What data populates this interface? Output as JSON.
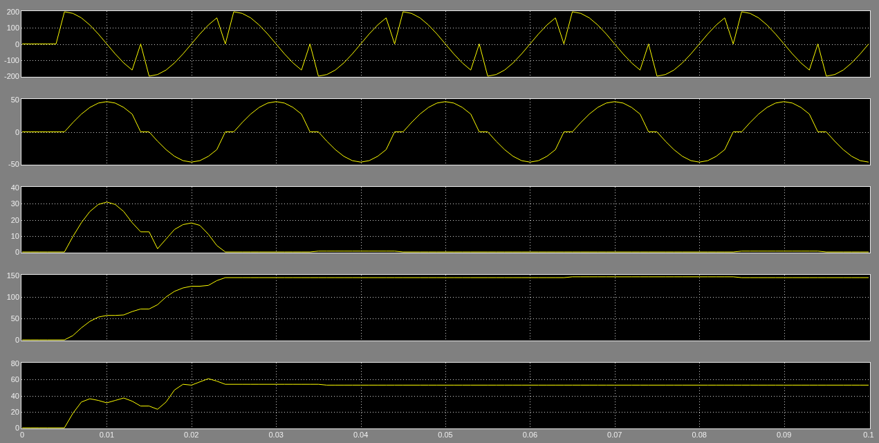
{
  "plots": [
    {
      "chart_data": {
        "type": "line",
        "grid": true,
        "xlim": [
          0,
          0.1
        ],
        "ylim": [
          -200,
          200
        ],
        "yticks": [
          200,
          100,
          0,
          -100,
          -200
        ],
        "x": [
          0,
          0.001,
          0.002,
          0.003,
          0.004,
          0.005,
          0.006,
          0.007,
          0.008,
          0.009,
          0.01,
          0.011,
          0.012,
          0.013,
          0.014,
          0.015,
          0.016,
          0.017,
          0.018,
          0.019,
          0.02,
          0.021,
          0.022,
          0.023,
          0.024,
          0.025,
          0.026,
          0.027,
          0.028,
          0.029,
          0.03,
          0.031,
          0.032,
          0.033,
          0.034,
          0.035,
          0.036,
          0.037,
          0.038,
          0.039,
          0.04,
          0.041,
          0.042,
          0.043,
          0.044,
          0.045,
          0.046,
          0.047,
          0.048,
          0.049,
          0.05,
          0.051,
          0.052,
          0.053,
          0.054,
          0.055,
          0.056,
          0.057,
          0.058,
          0.059,
          0.06,
          0.061,
          0.062,
          0.063,
          0.064,
          0.065,
          0.066,
          0.067,
          0.068,
          0.069,
          0.07,
          0.071,
          0.072,
          0.073,
          0.074,
          0.075,
          0.076,
          0.077,
          0.078,
          0.079,
          0.08,
          0.081,
          0.082,
          0.083,
          0.084,
          0.085,
          0.086,
          0.087,
          0.088,
          0.089,
          0.09,
          0.091,
          0.092,
          0.093,
          0.094,
          0.095,
          0.096,
          0.097,
          0.098,
          0.099,
          0.1
        ],
        "series": [
          {
            "color": "#ffff00",
            "values": [
              0,
              0,
              0,
              0,
              0,
              200,
              190,
              162,
              118,
              62,
              0,
              -62,
              -118,
              -162,
              0,
              -200,
              -190,
              -162,
              -118,
              -62,
              0,
              62,
              118,
              162,
              0,
              200,
              190,
              162,
              118,
              62,
              0,
              -62,
              -118,
              -162,
              0,
              -200,
              -190,
              -162,
              -118,
              -62,
              0,
              62,
              118,
              162,
              0,
              200,
              190,
              162,
              118,
              62,
              0,
              -62,
              -118,
              -162,
              0,
              -200,
              -190,
              -162,
              -118,
              -62,
              0,
              62,
              118,
              162,
              0,
              200,
              190,
              162,
              118,
              62,
              0,
              -62,
              -118,
              -162,
              0,
              -200,
              -190,
              -162,
              -118,
              -62,
              0,
              62,
              118,
              162,
              0,
              200,
              190,
              162,
              118,
              62,
              0,
              -62,
              -118,
              -162,
              0,
              -200,
              -190,
              -162,
              -118,
              -62,
              0
            ]
          }
        ]
      }
    },
    {
      "chart_data": {
        "type": "line",
        "grid": true,
        "xlim": [
          0,
          0.1
        ],
        "ylim": [
          -50,
          50
        ],
        "yticks": [
          50,
          0,
          -50
        ],
        "x": [
          0,
          0.001,
          0.002,
          0.003,
          0.004,
          0.005,
          0.006,
          0.007,
          0.008,
          0.009,
          0.01,
          0.011,
          0.012,
          0.013,
          0.014,
          0.015,
          0.016,
          0.017,
          0.018,
          0.019,
          0.02,
          0.021,
          0.022,
          0.023,
          0.024,
          0.025,
          0.026,
          0.027,
          0.028,
          0.029,
          0.03,
          0.031,
          0.032,
          0.033,
          0.034,
          0.035,
          0.036,
          0.037,
          0.038,
          0.039,
          0.04,
          0.041,
          0.042,
          0.043,
          0.044,
          0.045,
          0.046,
          0.047,
          0.048,
          0.049,
          0.05,
          0.051,
          0.052,
          0.053,
          0.054,
          0.055,
          0.056,
          0.057,
          0.058,
          0.059,
          0.06,
          0.061,
          0.062,
          0.063,
          0.064,
          0.065,
          0.066,
          0.067,
          0.068,
          0.069,
          0.07,
          0.071,
          0.072,
          0.073,
          0.074,
          0.075,
          0.076,
          0.077,
          0.078,
          0.079,
          0.08,
          0.081,
          0.082,
          0.083,
          0.084,
          0.085,
          0.086,
          0.087,
          0.088,
          0.089,
          0.09,
          0.091,
          0.092,
          0.093,
          0.094,
          0.095,
          0.096,
          0.097,
          0.098,
          0.099,
          0.1
        ],
        "series": [
          {
            "color": "#ffff00",
            "values": [
              0,
              0,
              0,
              0,
              0,
              0,
              14.5,
              27.6,
              38,
              44.7,
              47,
              44.7,
              38,
              27.6,
              0,
              0,
              -14.5,
              -27.6,
              -38,
              -44.7,
              -47,
              -44.7,
              -38,
              -27.6,
              0,
              0,
              14.5,
              27.6,
              38,
              44.7,
              47,
              44.7,
              38,
              27.6,
              0,
              0,
              -14.5,
              -27.6,
              -38,
              -44.7,
              -47,
              -44.7,
              -38,
              -27.6,
              0,
              0,
              14.5,
              27.6,
              38,
              44.7,
              47,
              44.7,
              38,
              27.6,
              0,
              0,
              -14.5,
              -27.6,
              -38,
              -44.7,
              -47,
              -44.7,
              -38,
              -27.6,
              0,
              0,
              14.5,
              27.6,
              38,
              44.7,
              47,
              44.7,
              38,
              27.6,
              0,
              0,
              -14.5,
              -27.6,
              -38,
              -44.7,
              -47,
              -44.7,
              -38,
              -27.6,
              0,
              0,
              14.5,
              27.6,
              38,
              44.7,
              47,
              44.7,
              38,
              27.6,
              0,
              0,
              -14.5,
              -27.6,
              -38,
              -44.7,
              -47
            ]
          }
        ]
      }
    },
    {
      "chart_data": {
        "type": "line",
        "grid": true,
        "xlim": [
          0,
          0.1
        ],
        "ylim": [
          0,
          40
        ],
        "yticks": [
          40,
          30,
          20,
          10,
          0
        ],
        "x": [
          0,
          0.001,
          0.002,
          0.003,
          0.004,
          0.005,
          0.006,
          0.007,
          0.008,
          0.009,
          0.01,
          0.011,
          0.012,
          0.013,
          0.014,
          0.015,
          0.016,
          0.017,
          0.018,
          0.019,
          0.02,
          0.021,
          0.022,
          0.023,
          0.024,
          0.025,
          0.026,
          0.027,
          0.028,
          0.029,
          0.03,
          0.031,
          0.032,
          0.033,
          0.034,
          0.035,
          0.036,
          0.037,
          0.038,
          0.039,
          0.04,
          0.041,
          0.042,
          0.043,
          0.044,
          0.045,
          0.046,
          0.047,
          0.048,
          0.049,
          0.05,
          0.051,
          0.052,
          0.053,
          0.054,
          0.055,
          0.056,
          0.057,
          0.058,
          0.059,
          0.06,
          0.061,
          0.062,
          0.063,
          0.064,
          0.065,
          0.066,
          0.067,
          0.068,
          0.069,
          0.07,
          0.071,
          0.072,
          0.073,
          0.074,
          0.075,
          0.076,
          0.077,
          0.078,
          0.079,
          0.08,
          0.081,
          0.082,
          0.083,
          0.084,
          0.085,
          0.086,
          0.087,
          0.088,
          0.089,
          0.09,
          0.091,
          0.092,
          0.093,
          0.094,
          0.095,
          0.096,
          0.097,
          0.098,
          0.099,
          0.1
        ],
        "series": [
          {
            "color": "#ffff00",
            "values": [
              0,
              0,
              0,
              0,
              0,
              0,
              9.6,
              18.2,
              25.1,
              29.5,
              31,
              29.5,
              25.1,
              18.2,
              12.5,
              12.5,
              2,
              8,
              14,
              17,
              18,
              16.5,
              11,
              4,
              0,
              0,
              0,
              0,
              0,
              0,
              0,
              0,
              0,
              0,
              0,
              0.5,
              0.5,
              0.5,
              0.5,
              0.5,
              0.5,
              0.5,
              0.5,
              0.5,
              0.5,
              0,
              0,
              0,
              0,
              0,
              0,
              0,
              0,
              0,
              0,
              0,
              0,
              0,
              0,
              0,
              0,
              0,
              0,
              0,
              0,
              0,
              0,
              0,
              0,
              0,
              0,
              0,
              0,
              0,
              0,
              0,
              0,
              0,
              0,
              0,
              0,
              0,
              0,
              0,
              0,
              0.5,
              0.5,
              0.5,
              0.5,
              0.5,
              0.5,
              0.5,
              0.5,
              0.5,
              0.5,
              0,
              0,
              0,
              0,
              0,
              0
            ]
          }
        ]
      }
    },
    {
      "chart_data": {
        "type": "line",
        "grid": true,
        "xlim": [
          0,
          0.1
        ],
        "ylim": [
          0,
          150
        ],
        "yticks": [
          150,
          100,
          50,
          0
        ],
        "x": [
          0,
          0.001,
          0.002,
          0.003,
          0.004,
          0.005,
          0.006,
          0.007,
          0.008,
          0.009,
          0.01,
          0.011,
          0.012,
          0.013,
          0.014,
          0.015,
          0.016,
          0.017,
          0.018,
          0.019,
          0.02,
          0.021,
          0.022,
          0.023,
          0.024,
          0.025,
          0.026,
          0.027,
          0.028,
          0.029,
          0.03,
          0.031,
          0.032,
          0.033,
          0.034,
          0.035,
          0.036,
          0.037,
          0.038,
          0.039,
          0.04,
          0.041,
          0.042,
          0.043,
          0.044,
          0.045,
          0.046,
          0.047,
          0.048,
          0.049,
          0.05,
          0.051,
          0.052,
          0.053,
          0.054,
          0.055,
          0.056,
          0.057,
          0.058,
          0.059,
          0.06,
          0.061,
          0.062,
          0.063,
          0.064,
          0.065,
          0.066,
          0.067,
          0.068,
          0.069,
          0.07,
          0.071,
          0.072,
          0.073,
          0.074,
          0.075,
          0.076,
          0.077,
          0.078,
          0.079,
          0.08,
          0.081,
          0.082,
          0.083,
          0.084,
          0.085,
          0.086,
          0.087,
          0.088,
          0.089,
          0.09,
          0.091,
          0.092,
          0.093,
          0.094,
          0.095,
          0.096,
          0.097,
          0.098,
          0.099,
          0.1
        ],
        "series": [
          {
            "color": "#ffff00",
            "values": [
              0,
              0,
              0,
              0,
              0,
              0,
              10,
              28,
              43,
              53,
              57,
              57,
              58,
              66,
              72,
              72,
              82,
              100,
              113,
              121,
              125,
              125,
              127,
              138,
              145,
              145,
              145,
              145,
              145,
              145,
              145,
              145,
              145,
              145,
              145,
              145,
              145,
              145,
              145,
              145,
              145,
              145,
              145,
              145,
              145,
              145,
              145,
              145,
              145,
              145,
              145,
              145,
              145,
              145,
              145,
              145,
              145,
              145,
              145,
              145,
              145,
              145,
              145,
              145,
              145,
              147,
              147,
              147,
              147,
              147,
              147,
              147,
              147,
              147,
              147,
              147,
              147,
              147,
              147,
              147,
              147,
              147,
              147,
              147,
              147,
              145,
              145,
              145,
              145,
              145,
              145,
              145,
              145,
              145,
              145,
              145,
              145,
              145,
              145,
              145,
              145
            ]
          }
        ]
      }
    },
    {
      "chart_data": {
        "type": "line",
        "grid": true,
        "xlim": [
          0,
          0.1
        ],
        "ylim": [
          0,
          80
        ],
        "yticks": [
          80,
          60,
          40,
          20,
          0
        ],
        "xticks": [
          0,
          0.01,
          0.02,
          0.03,
          0.04,
          0.05,
          0.06,
          0.07,
          0.08,
          0.09,
          0.1
        ],
        "x": [
          0,
          0.001,
          0.002,
          0.003,
          0.004,
          0.005,
          0.006,
          0.007,
          0.008,
          0.009,
          0.01,
          0.011,
          0.012,
          0.013,
          0.014,
          0.015,
          0.016,
          0.017,
          0.018,
          0.019,
          0.02,
          0.021,
          0.022,
          0.023,
          0.024,
          0.025,
          0.026,
          0.027,
          0.028,
          0.029,
          0.03,
          0.031,
          0.032,
          0.033,
          0.034,
          0.035,
          0.036,
          0.037,
          0.038,
          0.039,
          0.04,
          0.041,
          0.042,
          0.043,
          0.044,
          0.045,
          0.046,
          0.047,
          0.048,
          0.049,
          0.05,
          0.051,
          0.052,
          0.053,
          0.054,
          0.055,
          0.056,
          0.057,
          0.058,
          0.059,
          0.06,
          0.061,
          0.062,
          0.063,
          0.064,
          0.065,
          0.066,
          0.067,
          0.068,
          0.069,
          0.07,
          0.071,
          0.072,
          0.073,
          0.074,
          0.075,
          0.076,
          0.077,
          0.078,
          0.079,
          0.08,
          0.081,
          0.082,
          0.083,
          0.084,
          0.085,
          0.086,
          0.087,
          0.088,
          0.089,
          0.09,
          0.091,
          0.092,
          0.093,
          0.094,
          0.095,
          0.096,
          0.097,
          0.098,
          0.099,
          0.1
        ],
        "series": [
          {
            "color": "#ffff00",
            "values": [
              0,
              0,
              0,
              0,
              0,
              0,
              18,
              32,
              36,
              34,
              31,
              34,
              37,
              33,
              27,
              27,
              23,
              32,
              47,
              54,
              53,
              57,
              61,
              58,
              54,
              54,
              54,
              54,
              54,
              54,
              54,
              54,
              54,
              54,
              54,
              54,
              53,
              53,
              53,
              53,
              53,
              53,
              53,
              53,
              53,
              53,
              53,
              53,
              53,
              53,
              53,
              53,
              53,
              53,
              53,
              53,
              53,
              53,
              53,
              53,
              53,
              53,
              53,
              53,
              53,
              53,
              53,
              53,
              53,
              53,
              53,
              53,
              53,
              53,
              53,
              53,
              53,
              53,
              53,
              53,
              53,
              53,
              53,
              53,
              53,
              53,
              53,
              53,
              53,
              53,
              53,
              53,
              53,
              53,
              53,
              53,
              53,
              53,
              53,
              53,
              53
            ]
          }
        ]
      }
    }
  ]
}
